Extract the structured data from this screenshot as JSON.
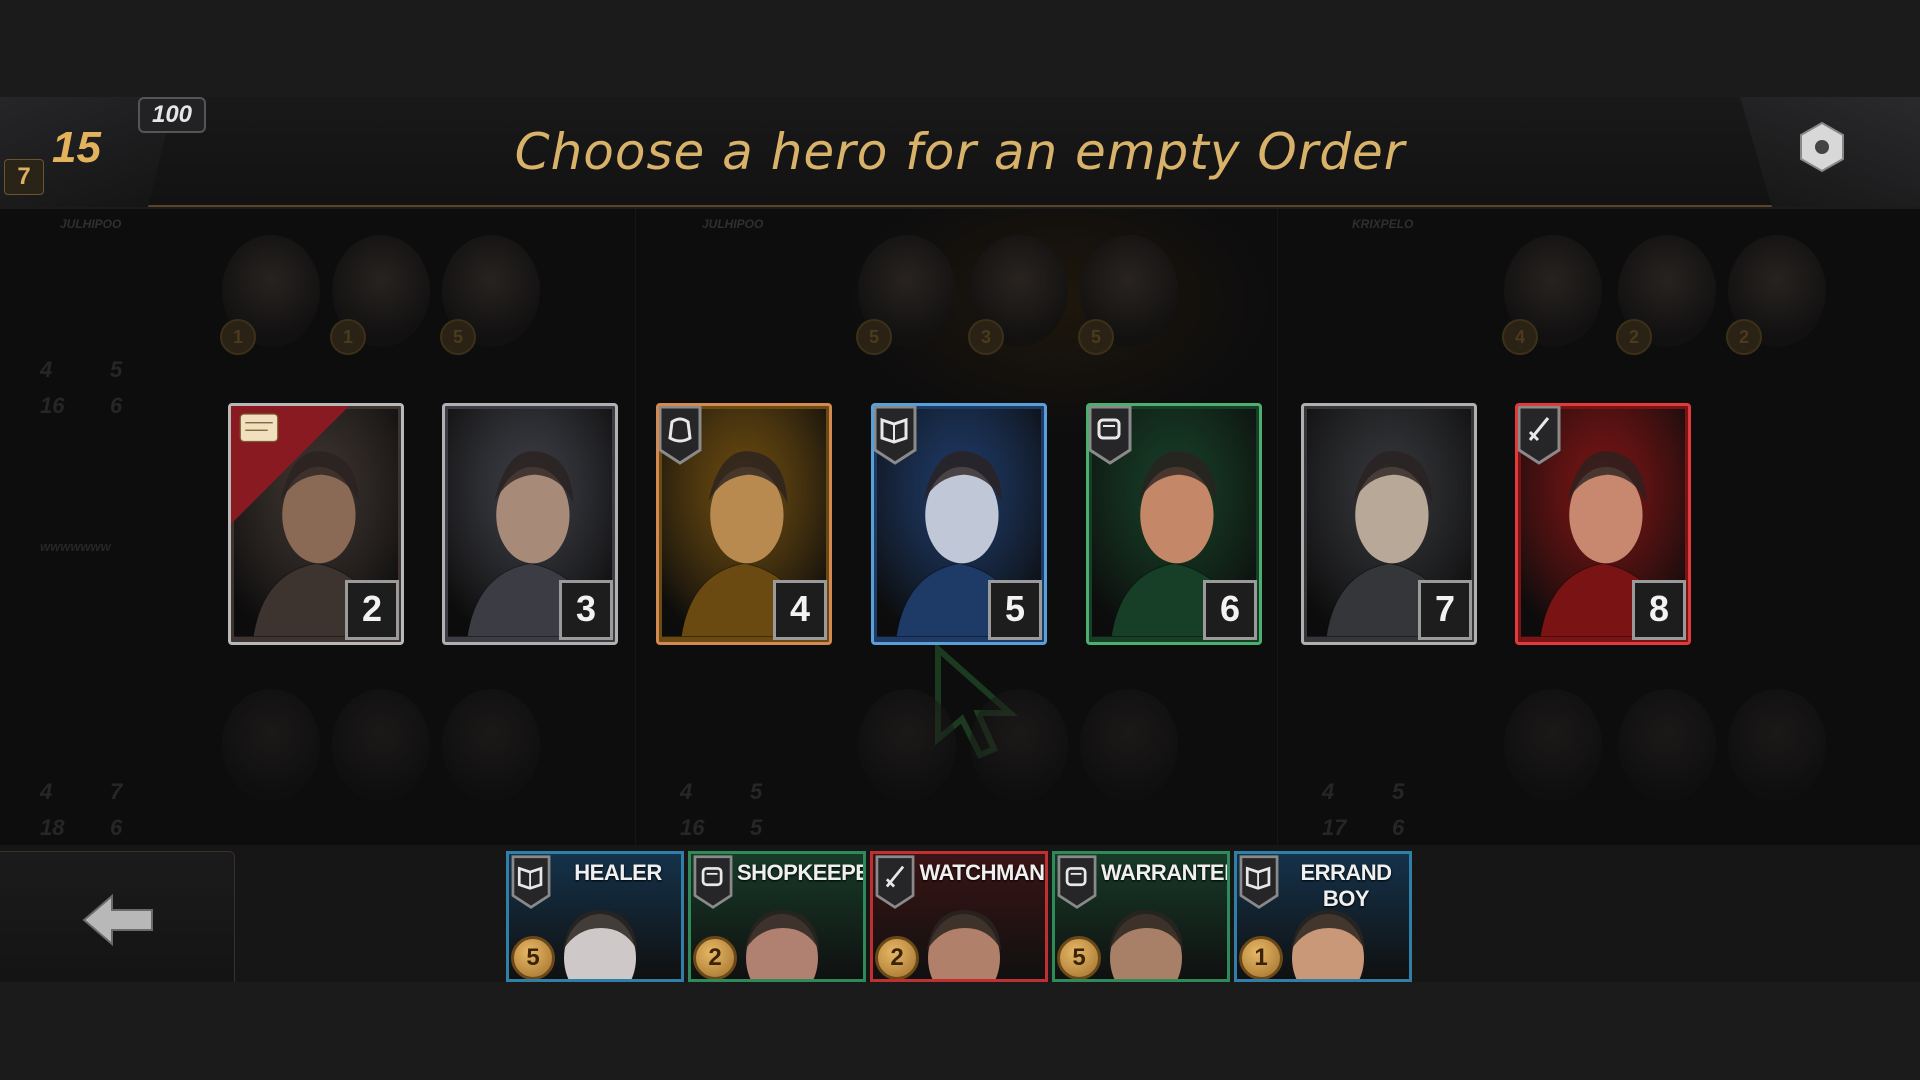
{
  "header": {
    "title": "Choose a hero for an empty Order",
    "stat_main": "15",
    "stat_sub": "7",
    "stat_cap": "100"
  },
  "board": {
    "zones": [
      {
        "name": "JULHIPOO",
        "coins": [
          "1",
          "1",
          "5"
        ],
        "stats_top": [
          "4",
          "5",
          "16",
          "6"
        ],
        "stats_bottom": [
          "4",
          "7",
          "18",
          "6"
        ]
      },
      {
        "name": "JULHIPOO",
        "coins": [
          "5",
          "3",
          "5"
        ],
        "stats_top": [],
        "stats_bottom": [
          "4",
          "5",
          "16",
          "5"
        ]
      },
      {
        "name": "KRIXPELO",
        "coins": [
          "4",
          "2",
          "2"
        ],
        "stats_top": [],
        "stats_bottom": [
          "4",
          "5",
          "17",
          "6"
        ]
      }
    ],
    "zone_caption": "wwwwwww"
  },
  "candidates": [
    {
      "number": "2",
      "frame": "#b8b8b8",
      "tone": "#3d3430",
      "skin": "#8a6a55",
      "role_icon": "scroll-icon",
      "corner": true
    },
    {
      "number": "3",
      "frame": "#b0b0b0",
      "tone": "#3c3d44",
      "skin": "#a88a78",
      "role_icon": "",
      "corner": false
    },
    {
      "number": "4",
      "frame": "#d28a52",
      "tone": "#6a4a10",
      "skin": "#b88a50",
      "role_icon": "pouch-icon",
      "corner": false
    },
    {
      "number": "5",
      "frame": "#5aa0d8",
      "tone": "#1e3a66",
      "skin": "#c0c8d8",
      "role_icon": "book-icon",
      "corner": false
    },
    {
      "number": "6",
      "frame": "#4caf70",
      "tone": "#173e26",
      "skin": "#c48868",
      "role_icon": "coin-bag-icon",
      "corner": false
    },
    {
      "number": "7",
      "frame": "#b0b0b0",
      "tone": "#35363a",
      "skin": "#b8a898",
      "role_icon": "",
      "corner": false
    },
    {
      "number": "8",
      "frame": "#e03a3a",
      "tone": "#7a1414",
      "skin": "#c88870",
      "role_icon": "sword-icon",
      "corner": false
    }
  ],
  "roles": [
    {
      "label": "HEALER",
      "coin": "5",
      "border": "#2f7fa8",
      "bg": "#14324a",
      "icon": "book-icon",
      "skin": "#cfc8c8"
    },
    {
      "label": "SHOPKEEPER",
      "coin": "2",
      "border": "#2f8a5a",
      "bg": "#173a28",
      "icon": "coin-bag-icon",
      "skin": "#b08070"
    },
    {
      "label": "WATCHMAN",
      "coin": "2",
      "border": "#c03030",
      "bg": "#3a1414",
      "icon": "sword-icon",
      "skin": "#b0806a"
    },
    {
      "label": "WARRANTER",
      "coin": "5",
      "border": "#2f8a5a",
      "bg": "#173a28",
      "icon": "coin-bag-icon",
      "skin": "#a88068"
    },
    {
      "label": "ERRAND BOY",
      "coin": "1",
      "border": "#2f7fa8",
      "bg": "#14324a",
      "icon": "book-icon",
      "skin": "#c89878"
    }
  ]
}
